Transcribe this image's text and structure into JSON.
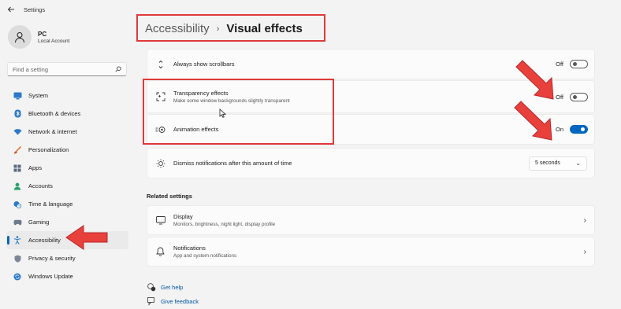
{
  "window": {
    "title": "Settings"
  },
  "user": {
    "name": "PC",
    "account_type": "Local Account"
  },
  "search": {
    "placeholder": "Find a setting"
  },
  "sidebar": {
    "items": [
      {
        "label": "System",
        "icon": "monitor-icon"
      },
      {
        "label": "Bluetooth & devices",
        "icon": "bluetooth-icon"
      },
      {
        "label": "Network & internet",
        "icon": "wifi-icon"
      },
      {
        "label": "Personalization",
        "icon": "brush-icon"
      },
      {
        "label": "Apps",
        "icon": "apps-icon"
      },
      {
        "label": "Accounts",
        "icon": "person-icon"
      },
      {
        "label": "Time & language",
        "icon": "globe-clock-icon"
      },
      {
        "label": "Gaming",
        "icon": "gamepad-icon"
      },
      {
        "label": "Accessibility",
        "icon": "accessibility-icon",
        "selected": true
      },
      {
        "label": "Privacy & security",
        "icon": "shield-icon"
      },
      {
        "label": "Windows Update",
        "icon": "update-icon"
      }
    ]
  },
  "breadcrumb": {
    "parent": "Accessibility",
    "separator": "›",
    "current": "Visual effects"
  },
  "settings": {
    "scrollbars": {
      "title": "Always show scrollbars",
      "state": "Off",
      "enabled": false
    },
    "transparency": {
      "title": "Transparency effects",
      "subtitle": "Make some window backgrounds slightly transparent",
      "state": "Off",
      "enabled": false
    },
    "animation": {
      "title": "Animation effects",
      "state": "On",
      "enabled": true
    },
    "notifications": {
      "title": "Dismiss notifications after this amount of time",
      "value": "5 seconds"
    }
  },
  "related": {
    "heading": "Related settings",
    "display": {
      "title": "Display",
      "subtitle": "Monitors, brightness, night light, display profile"
    },
    "notifications": {
      "title": "Notifications",
      "subtitle": "App and system notifications"
    }
  },
  "links": {
    "help": "Get help",
    "feedback": "Give feedback"
  },
  "colors": {
    "accent": "#0067c0",
    "annotation": "#e0393a",
    "background": "#f3f3f3"
  }
}
